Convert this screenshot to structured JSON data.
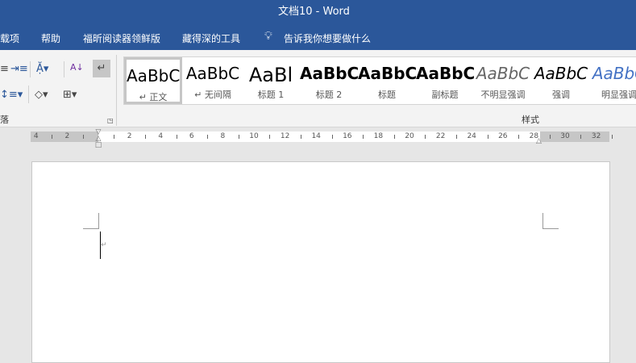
{
  "title": "文档10  -  Word",
  "tabs": [
    "载项",
    "帮助",
    "福昕阅读器领鲜版",
    "藏得深的工具",
    "告诉我你想要做什么"
  ],
  "styles": [
    {
      "sample": "AaBbC",
      "label": "↵ 正文"
    },
    {
      "sample": "AaBbC",
      "label": "↵ 无间隔"
    },
    {
      "sample": "AaBl",
      "label": "标题 1"
    },
    {
      "sample": "AaBbC",
      "label": "标题 2"
    },
    {
      "sample": "AaBbC",
      "label": "标题"
    },
    {
      "sample": "AaBbC",
      "label": "副标题"
    },
    {
      "sample": "AaBbC",
      "label": "不明显强调"
    },
    {
      "sample": "AaBbC",
      "label": "强调"
    },
    {
      "sample": "AaBbC",
      "label": "明显强调"
    }
  ],
  "groups": {
    "paragraph": "落",
    "styles": "样式"
  },
  "ruler": {
    "left": [
      "4",
      "2"
    ],
    "right": [
      "2",
      "4",
      "6",
      "8",
      "10",
      "12",
      "14",
      "16",
      "18",
      "20",
      "22",
      "24",
      "26",
      "28",
      "30",
      "32"
    ]
  },
  "colors": {
    "brand": "#2b579a",
    "accent_style": "#4472c4"
  }
}
